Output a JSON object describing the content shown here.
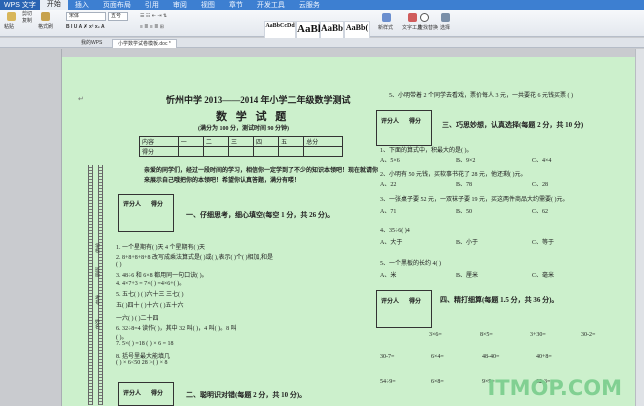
{
  "app": {
    "name": "WPS 文字",
    "tabs": [
      "开始",
      "插入",
      "页面布局",
      "引用",
      "审阅",
      "视图",
      "章节",
      "开发工具",
      "云服务"
    ]
  },
  "ribbon": {
    "paste": "粘贴",
    "cut": "剪切",
    "copy": "复制",
    "format_painter": "格式刷",
    "font": "宋体",
    "size": "五号",
    "styles": [
      {
        "sample": "AaBbCcDd",
        "label": "正文"
      },
      {
        "sample": "AaBl",
        "label": "标题 1"
      },
      {
        "sample": "AaBb",
        "label": "标题 2"
      },
      {
        "sample": "AaBb(",
        "label": "标题 3"
      }
    ],
    "new_style": "新样式",
    "text_tool": "文字工具",
    "find_replace": "查找替换",
    "select": "选择"
  },
  "doctabs": [
    "我的WPS",
    "小学数学试卷模板.doc *"
  ],
  "doc": {
    "title": "忻州中学 2013——2014 年小学二年级数学测试",
    "subtitle": "数 学 试 题",
    "score_note": "(满分为 100 分，测试时间 90 分钟)",
    "score_table": [
      [
        "内容",
        "一",
        "二",
        "三",
        "四",
        "五",
        "总分"
      ],
      [
        "得分",
        "",
        "",
        "",
        "",
        "",
        ""
      ]
    ],
    "intro1": "亲爱的同学们，经过一段时间的学习，相信你一定学到了不少的知识本领吧！现在就请你",
    "intro2": "来展示自己哦把你的本领吧！希望你认真答题，满分有喽！",
    "score_box": {
      "a": "评分人",
      "b": "得分"
    },
    "sec1": "一、仔细思考，细心填空(每空 1 分，共 26 分)。",
    "q1": [
      "1. 一个星期有(    )天 4 个星期有(    )天",
      "2. 8+8+8+8+8 改写成乘法算式是(    )或(    ),表示(    )个(    )相加,和是",
      "(        )",
      "3. 48÷6 和 6×8 都用同一句口诀(          )。",
      "4. 4×7+3 = 7×(    )    =4×6+(    )。",
      "5. 五七(    )      (    )六十三      三七(    )",
      "    五(    )四十      (    )十六        (    )五十六",
      "    一六(    )      (    )二十四",
      "6. 32÷8=4 读作(            )，其中 32 叫(        )，4 叫(        )。8 叫",
      "(        )。",
      "7. 5×(    ) =18      (    ) × 6 = 18",
      "8. 括号里最大能填几",
      "    (    ) × 6<50        28 >(    ) × 8"
    ],
    "sec2": "二、聪明识对错(每题 2 分，共 10 分)。",
    "q5": "5、小明带着 2 个同学去看戏，票价每人 3 元，一共要花 6 元钱买票  (    )",
    "sec3": "三、巧思妙想，认真选择(每题 2 分，共 10 分)",
    "choices": [
      {
        "q": "1、下面的算式中，积最大的是(    )。",
        "opts": [
          "A、5×6",
          "B、9×2",
          "C、4×4"
        ]
      },
      {
        "q": "2、小明有 50 元钱，买软事书花了 28 元，他还剩(    )元。",
        "opts": [
          "A、22",
          "B、78",
          "C、28"
        ]
      },
      {
        "q": "3、一张桌子要 52 元，一双袜子要 19 元，买这两件商品大约需要(    )元。",
        "opts": [
          "A、71",
          "B、50",
          "C、62"
        ]
      },
      {
        "q": "4、35÷6(    )4",
        "opts": [
          "A、大于",
          "B、小于",
          "C、等于"
        ]
      },
      {
        "q": "5、一个黑板的长约 4(    )",
        "opts": [
          "A、米",
          "B、厘米",
          "C、毫米"
        ]
      }
    ],
    "sec4": "四、精打细算(每题 1.5 分，共 36 分)。",
    "calc": [
      [
        "3×6=",
        "8×5=",
        "3+30=",
        "30-2="
      ],
      [
        "30-7=",
        "6×4=",
        "48-40=",
        "40+8="
      ],
      [
        "54÷9=",
        "6×8=",
        "9×9=",
        "62-3="
      ]
    ],
    "binding_labels": [
      "学校",
      "班级",
      "考号",
      "姓名"
    ]
  },
  "watermark": "ITMOP.COM"
}
